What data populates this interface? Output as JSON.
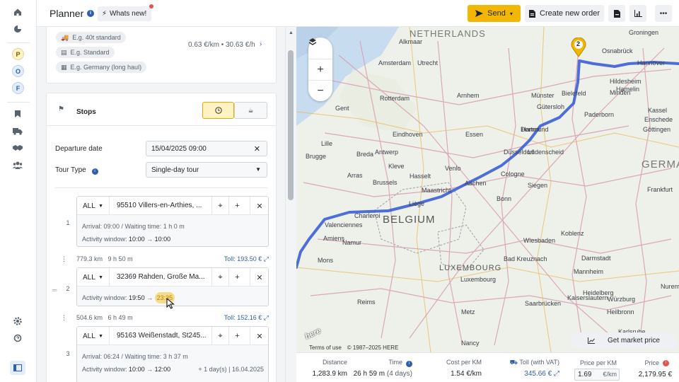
{
  "app": {
    "title": "Planner",
    "whats_new": "Whats new!"
  },
  "rail": {
    "badges": [
      {
        "letter": "P",
        "bg": "#fff3c4",
        "fg": "#7a5b00"
      },
      {
        "letter": "O",
        "bg": "#e3edfb",
        "fg": "#2e5fa8"
      },
      {
        "letter": "F",
        "bg": "#e3edfb",
        "fg": "#2e5fa8"
      }
    ]
  },
  "toolbar": {
    "send": "Send",
    "create_order": "Create new order"
  },
  "vehicle": {
    "chips": [
      "E.g. 40t standard",
      "E.g. Standard",
      "E.g. Germany (long haul)"
    ],
    "rate": "0.63 €/km • 30.63 €/h"
  },
  "stops": {
    "title": "Stops",
    "departure_label": "Departure date",
    "departure_value": "15/04/2025 09:00",
    "tour_label": "Tour Type",
    "tour_value": "Single-day tour",
    "items": [
      {
        "num": "1",
        "scope": "ALL",
        "address": "95510 Villers-en-Arthies, ...",
        "line1": "Arrival: 09:00 / Waiting time: 1 h 0 m",
        "aw_label": "Activity window:",
        "aw_from": "10:00",
        "aw_to": "10:00",
        "extra": ""
      },
      {
        "num": "2",
        "scope": "ALL",
        "address": "32369 Rahden, Große Ma...",
        "line1": "",
        "aw_label": "Activity window:",
        "aw_from": "19:50",
        "aw_to": "23:35",
        "extra": ""
      },
      {
        "num": "3",
        "scope": "ALL",
        "address": "95163 Weißenstadt, St245...",
        "line1": "Arrival: 06:24 / Waiting time: 3 h 37 m",
        "aw_label": "Activity window:",
        "aw_from": "10:00",
        "aw_to": "12:00",
        "extra": "+ 1 day(s) | 16.04.2025"
      }
    ],
    "legs": [
      {
        "dist": "779.3 km",
        "time": "9 h 50 m",
        "toll": "Toll: 193.50 €"
      },
      {
        "dist": "504.6 km",
        "time": "6 h 49 m",
        "toll": "Toll: 152.16 €"
      }
    ]
  },
  "map": {
    "labels": [
      "NETHERLANDS",
      "Alkmaar",
      "Amsterdam",
      "Rotterdam",
      "Antwerp",
      "Brussels",
      "BELGIUM",
      "Charleroi",
      "Valenciennes",
      "Maastricht",
      "Aachen",
      "Cologne",
      "Bonn",
      "Düsseldorf",
      "Essen",
      "Dortmund",
      "Münster",
      "Bielefeld",
      "Hannover",
      "Hildesheim",
      "Göttingen",
      "Paderborn",
      "Siegen",
      "Koblenz",
      "Wiesbaden",
      "Darmstadt",
      "Mannheim",
      "Heidelberg",
      "Heilbronn",
      "Nuremb",
      "GERMA",
      "Würzburg",
      "LUXEMBOURG",
      "Luxembourg",
      "Saarbrücken",
      "Metz",
      "Nancy",
      "Reims",
      "Amiens",
      "Arras",
      "Lille",
      "Gent",
      "Brugge",
      "Eindhoven",
      "Hamelin",
      "Minden",
      "Lüdenscheid",
      "Kassel",
      "Bad Kreuznach",
      "Kaiserslautern",
      "Karlsruhe",
      "Frankfurt",
      "Groningen",
      "Breda",
      "Hasselt",
      "Liège",
      "Namur",
      "Mons",
      "Arnhem",
      "Utrecht",
      "Enschede",
      "Osnabrück",
      "Gütersloh",
      "Hamm",
      "Kleve",
      "Venlo"
    ],
    "marker": "2",
    "attribution_terms": "Terms of use",
    "attribution_copy": "© 1987–2025 HERE",
    "here_logo": "here"
  },
  "stats": {
    "distance": {
      "label": "Distance",
      "value": "1,283.9 km"
    },
    "time": {
      "label": "Time",
      "value": "26 h 59 m",
      "sub": "(4 days)"
    },
    "cost": {
      "label": "Cost per KM",
      "value": "1.54 €/km"
    },
    "toll": {
      "label": "Toll (with VAT)",
      "value": "345.66 €"
    }
  },
  "pricing": {
    "market_btn": "Get market price",
    "per_km_label": "Price per KM",
    "per_km_value": "1.69",
    "per_km_unit": "€/km",
    "price_label": "Price",
    "price_value": "2,179.95 €"
  },
  "colors": {
    "accent": "#f2b705",
    "route": "#3b5fd6",
    "link": "#2e5fa8"
  }
}
